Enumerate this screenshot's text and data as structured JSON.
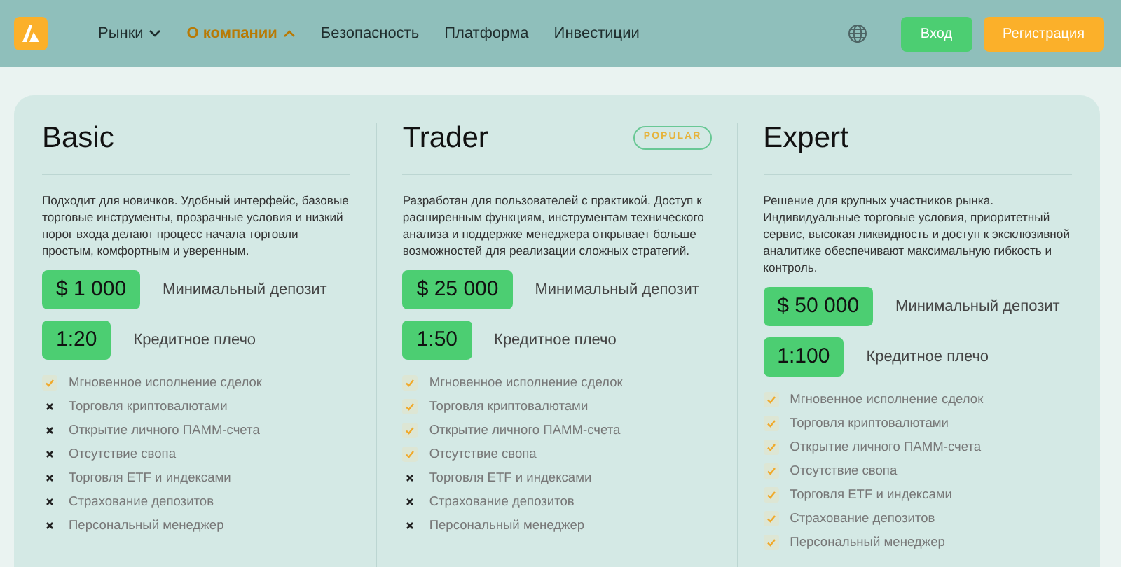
{
  "header": {
    "nav": [
      {
        "label": "Рынки",
        "selected": false,
        "expanded": false
      },
      {
        "label": "О компании",
        "selected": true,
        "expanded": true
      },
      {
        "label": "Безопасность",
        "selected": false
      },
      {
        "label": "Платформа",
        "selected": false
      },
      {
        "label": "Инвестиции",
        "selected": false
      }
    ],
    "login": "Вход",
    "register": "Регистрация"
  },
  "plans": [
    {
      "name": "Basic",
      "description": "Подходит для новичков. Удобный интерфейс, базовые торговые инструменты, прозрачные условия и низкий порог входа делают процесс начала торговли простым, комфортным и уверенным.",
      "deposit": "$ 1 000",
      "deposit_label": "Минимальный депозит",
      "leverage": "1:20",
      "leverage_label": "Кредитное плечо",
      "features": [
        {
          "text": "Мгновенное исполнение сделок",
          "included": true
        },
        {
          "text": "Торговля криптовалютами",
          "included": false
        },
        {
          "text": "Открытие личного ПАММ-счета",
          "included": false
        },
        {
          "text": "Отсутствие свопа",
          "included": false
        },
        {
          "text": "Торговля ETF и индексами",
          "included": false
        },
        {
          "text": "Страхование депозитов",
          "included": false
        },
        {
          "text": "Персональный менеджер",
          "included": false
        }
      ]
    },
    {
      "name": "Trader",
      "badge": "POPULAR",
      "description": "Разработан для пользователей с практикой. Доступ к расширенным функциям, инструментам технического анализа и поддержке менеджера открывает больше возможностей для реализации сложных стратегий.",
      "deposit": "$ 25 000",
      "deposit_label": "Минимальный депозит",
      "leverage": "1:50",
      "leverage_label": "Кредитное плечо",
      "features": [
        {
          "text": "Мгновенное исполнение сделок",
          "included": true
        },
        {
          "text": "Торговля криптовалютами",
          "included": true
        },
        {
          "text": "Открытие личного ПАММ-счета",
          "included": true
        },
        {
          "text": "Отсутствие свопа",
          "included": true
        },
        {
          "text": "Торговля ETF и индексами",
          "included": false
        },
        {
          "text": "Страхование депозитов",
          "included": false
        },
        {
          "text": "Персональный менеджер",
          "included": false
        }
      ]
    },
    {
      "name": "Expert",
      "description": "Решение для крупных участников рынка. Индивидуальные торговые условия, приоритетный сервис, высокая ликвидность и доступ к эксклюзивной аналитике обеспечивают максимальную гибкость и контроль.",
      "deposit": "$ 50 000",
      "deposit_label": "Минимальный депозит",
      "leverage": "1:100",
      "leverage_label": "Кредитное плечо",
      "features": [
        {
          "text": "Мгновенное исполнение сделок",
          "included": true
        },
        {
          "text": "Торговля криптовалютами",
          "included": true
        },
        {
          "text": "Открытие личного ПАММ-счета",
          "included": true
        },
        {
          "text": "Отсутствие свопа",
          "included": true
        },
        {
          "text": "Торговля ETF и индексами",
          "included": true
        },
        {
          "text": "Страхование депозитов",
          "included": true
        },
        {
          "text": "Персональный менеджер",
          "included": true
        }
      ]
    }
  ]
}
